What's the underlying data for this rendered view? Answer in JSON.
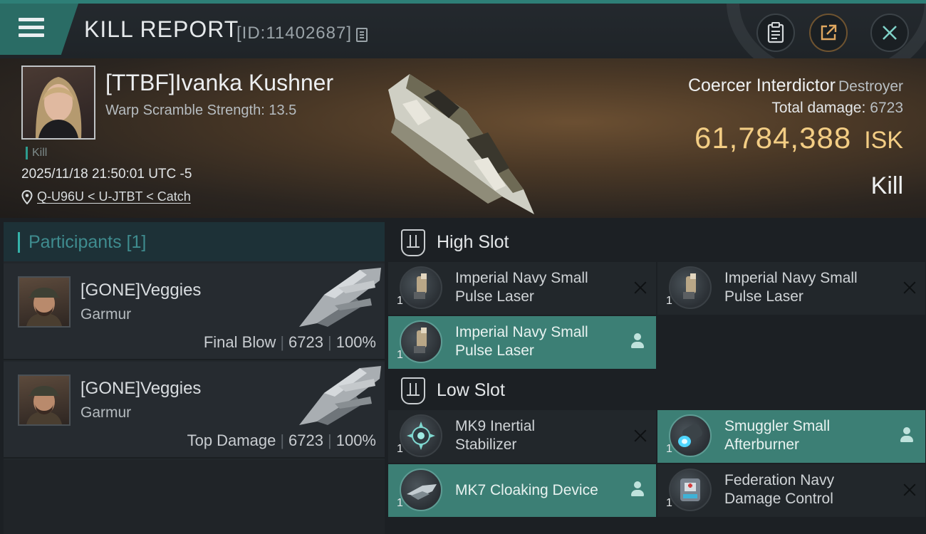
{
  "header": {
    "title": "KILL REPORT",
    "report_id": "[ID:11402687]"
  },
  "victim": {
    "name": "[TTBF]Ivanka Kushner",
    "scram_text": "Warp Scramble Strength: 13.5",
    "kill_tag": "Kill",
    "datetime": "2025/11/18 21:50:01 UTC -5",
    "location": "Q-U96U < U-JTBT < Catch",
    "ship_name": "Coercer Interdictor",
    "ship_class": "Destroyer",
    "total_damage_label": "Total damage:",
    "total_damage_value": "6723",
    "isk_value": "61,784,388",
    "isk_unit": "ISK",
    "result": "Kill"
  },
  "participants": {
    "title": "Participants [1]",
    "rows": [
      {
        "name": "[GONE]Veggies",
        "ship": "Garmur",
        "role": "Final Blow",
        "damage": "6723",
        "percent": "100%"
      },
      {
        "name": "[GONE]Veggies",
        "ship": "Garmur",
        "role": "Top Damage",
        "damage": "6723",
        "percent": "100%"
      }
    ]
  },
  "slots": {
    "high": {
      "title": "High Slot",
      "modules": [
        {
          "line1": "Imperial Navy Small",
          "line2": "Pulse Laser",
          "qty": "1",
          "state": "destroyed"
        },
        {
          "line1": "Imperial Navy Small",
          "line2": "Pulse Laser",
          "qty": "1",
          "state": "destroyed"
        },
        {
          "line1": "Imperial Navy Small",
          "line2": "Pulse Laser",
          "qty": "1",
          "state": "dropped"
        }
      ]
    },
    "low": {
      "title": "Low Slot",
      "modules": [
        {
          "line1": "MK9 Inertial",
          "line2": "Stabilizer",
          "qty": "1",
          "state": "destroyed"
        },
        {
          "line1": "Smuggler Small",
          "line2": "Afterburner",
          "qty": "1",
          "state": "dropped"
        },
        {
          "line1": "MK7 Cloaking Device",
          "line2": "",
          "qty": "1",
          "state": "dropped"
        },
        {
          "line1": "Federation Navy",
          "line2": "Damage Control",
          "qty": "1",
          "state": "destroyed"
        }
      ]
    }
  },
  "icons": {
    "menu": "menu-icon",
    "copy": "copy-icon",
    "clipboard": "clipboard-icon",
    "share": "share-icon",
    "close": "close-icon",
    "location": "location-pin-icon",
    "destroyed": "x-icon",
    "dropped": "person-icon"
  },
  "colors": {
    "accent_teal": "#2e7f77",
    "isk_gold": "#f3cd84",
    "dropped_bg": "#3c7f75",
    "panel_bg": "#22272b"
  }
}
